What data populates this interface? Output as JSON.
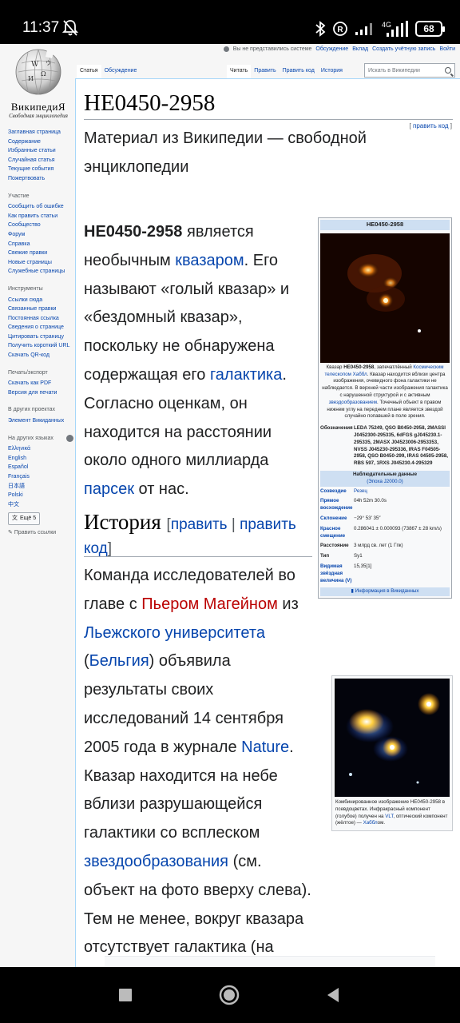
{
  "status_bar": {
    "time": "11:37",
    "network": "4G",
    "battery": "68",
    "icons": [
      "bell-off-icon",
      "bluetooth-icon",
      "registered-icon",
      "signal-icon",
      "signal-icon",
      "battery-icon"
    ]
  },
  "header": {
    "logo_title": "ВикипедиЯ",
    "logo_subtitle": "Свободная энциклопедия",
    "personal_links": [
      "Вы не представились системе",
      "Обсуждение",
      "Вклад",
      "Создать учётную запись",
      "Войти"
    ],
    "tabs_left": [
      "Статья",
      "Обсуждение"
    ],
    "tabs_right": [
      "Читать",
      "Править",
      "Править код",
      "История"
    ],
    "search_placeholder": "Искать в Википедии"
  },
  "sidebar": {
    "main_links": [
      "Заглавная страница",
      "Содержание",
      "Избранные статьи",
      "Случайная статья",
      "Текущие события",
      "Пожертвовать"
    ],
    "section_participation": "Участие",
    "participation_links": [
      "Сообщить об ошибке",
      "Как править статьи",
      "Сообщество",
      "Форум",
      "Справка",
      "Свежие правки",
      "Новые страницы",
      "Служебные страницы"
    ],
    "section_tools": "Инструменты",
    "tools_links": [
      "Ссылки сюда",
      "Связанные правки",
      "Постоянная ссылка",
      "Сведения о странице",
      "Цитировать страницу",
      "Получить короткий URL",
      "Скачать QR-код"
    ],
    "section_print": "Печать/экспорт",
    "print_links": [
      "Скачать как PDF",
      "Версия для печати"
    ],
    "section_projects": "В других проектах",
    "projects_links": [
      "Элемент Викиданных"
    ],
    "section_languages": "На других языках",
    "language_links": [
      "Ελληνικά",
      "English",
      "Español",
      "Français",
      "日本語",
      "Polski",
      "中文"
    ],
    "more_button": "Ещё 5",
    "edit_links": "Править ссылки"
  },
  "article": {
    "title": "HE0450-2958",
    "subtitle": "Материал из Википедии — свободной энциклопедии",
    "edit_small": "править код",
    "lead": {
      "bold": "HE0450-2958",
      "t1": " является необычным ",
      "l1": "квазаром",
      "t2": ". Его называют «голый квазар» и «бездомный квазар», поскольку не обнаружена содержащая его ",
      "l2": "галактика",
      "t3": ". Согласно оценкам, он находится на расстоянии около одного миллиарда ",
      "l3": "парсек",
      "t4": " от нас."
    },
    "section_title": "История",
    "section_edit1": "править",
    "section_sep": " | ",
    "section_edit2": "править код",
    "history": {
      "t1": "Команда исследователей во главе с ",
      "l1": "Пьером Магейном",
      "t2": " из ",
      "l2": "Льежского университета",
      "t3": " (",
      "l3": "Бельгия",
      "t4": ") объявила результаты своих исследований 14 сентября 2005 года в журнале ",
      "l4": "Nature",
      "t5": ". Квазар находится на небе вблизи разрушающейся галактики со всплеском ",
      "l5": "звездообразования",
      "t6": " (см. объект на фото вверху слева). Тем не менее, вокруг квазара отсутствует галактика (на фото в центре), что натолкнуло авторов на размышления."
    }
  },
  "infobox": {
    "title": "HE0450-2958",
    "caption_a": "Квазар ",
    "caption_b": "HE0450-2958",
    "caption_c": ", запечатлённый ",
    "caption_link": "Космическим телескопом Хаббл",
    "caption_d": ". Квазар находится вблизи центра изображения, очевидного фона галактики не наблюдается. В верхней части изображения галактика с нарушенной структурой и с активным ",
    "caption_link2": "звездообразованием",
    "caption_e": ". Точечный объект в правом нижнем углу на переднем плане является звездой случайно попавшей в поле зрения.",
    "designations_label": "Обозначения",
    "designations_value": "LEDA 75249, QSO B0450-2958, 2MASSI J0452300-295335, 6dFGS gJ045230.1-295335, 2MASX J04523006-2953353, NVSS J045230-295336, IRAS F04505-2958, QSO B0450-299, IRAS 04505-2958, RBS 597, 1RXS J045230.4-295329",
    "observed_header": "Наблюдательные данные",
    "epoch": "(Эпоха J2000.0)",
    "rows": [
      {
        "k": "Созвездие",
        "v": "Резец"
      },
      {
        "k": "Прямое восхождение",
        "v": "04h 52m 30.0s"
      },
      {
        "k": "Склонение",
        "v": "−29° 53′ 35″"
      },
      {
        "k": "Красное смещение",
        "v": "0.286041 ± 0.000093 (73867 ± 28 km/s)"
      },
      {
        "k": "Расстояние",
        "v": "3 млрд св. лет (1 Гпк)"
      },
      {
        "k": "Тип",
        "v": "Sy1"
      },
      {
        "k": "Видимая звёздная величина (V)",
        "v": "15,35[1]"
      }
    ],
    "footer": "Информация в Викиданных"
  },
  "thumb": {
    "caption_a": "Комбинированное изображение HE0450-2958 в псевдоцветах. Инфракрасный компонент (голубое) получен на ",
    "caption_link": "VLT",
    "caption_b": ", оптический компонент (жёлтое) — ",
    "caption_link2": "Хаббл",
    "caption_c": "ом."
  }
}
